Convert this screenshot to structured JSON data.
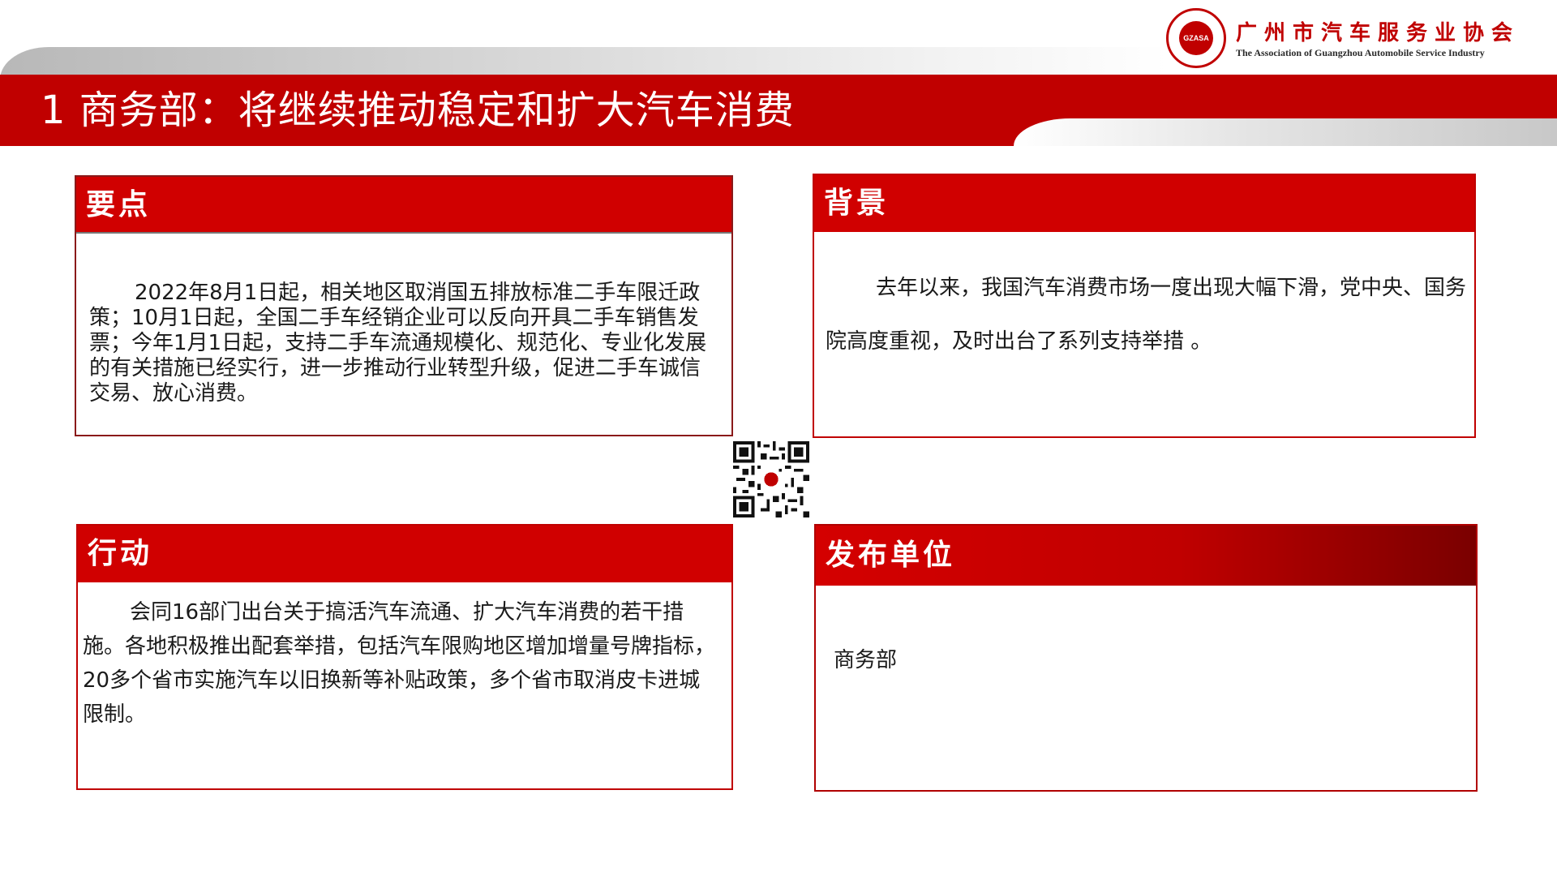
{
  "header": {
    "title": "1 商务部：将继续推动稳定和扩大汽车消费",
    "logo": {
      "name_cn": "广州市汽车服务业协会",
      "name_en": "The Association of Guangzhou Automobile Service Industry",
      "seal_text": "GZASA",
      "brand_color": "#c00000"
    }
  },
  "panels": {
    "key_points": {
      "heading": "要点",
      "body": "2022年8月1日起，相关地区取消国五排放标准二手车限迁政策；10月1日起，全国二手车经销企业可以反向开具二手车销售发票；今年1月1日起，支持二手车流通规模化、规范化、专业化发展的有关措施已经实行，进一步推动行业转型升级，促进二手车诚信交易、放心消费。"
    },
    "background": {
      "heading": "背景",
      "body": "去年以来，我国汽车消费市场一度出现大幅下滑，党中央、国务院高度重视，及时出台了系列支持举措 。"
    },
    "action": {
      "heading": "行动",
      "body": "会同16部门出台关于搞活汽车流通、扩大汽车消费的若干措施。各地积极推出配套举措，包括汽车限购地区增加增量号牌指标，20多个省市实施汽车以旧换新等补贴政策，多个省市取消皮卡进城限制。"
    },
    "publisher": {
      "heading": "发布单位",
      "body": "商务部"
    }
  },
  "qr_code": {
    "icon": "qr-code-icon"
  },
  "colors": {
    "accent": "#c00000",
    "panel_header": "#d00000",
    "dark_red": "#7a0000"
  }
}
